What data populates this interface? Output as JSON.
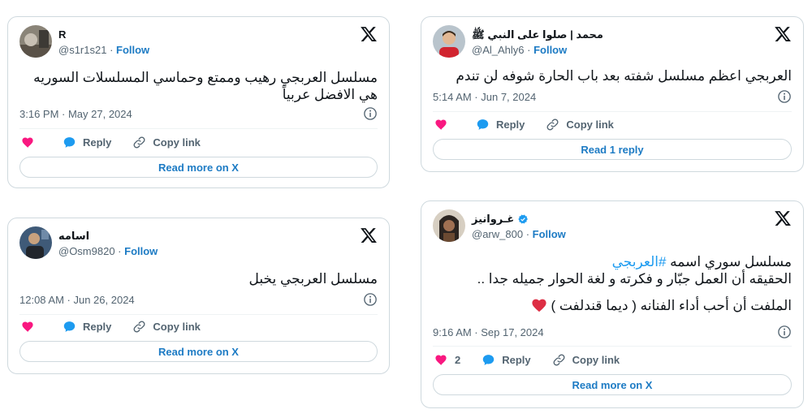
{
  "colors": {
    "accent": "#1d9bf0",
    "link": "#1d7bc4",
    "heart": "#f91880",
    "muted": "#536471",
    "border": "#cfd9de"
  },
  "tweets": [
    {
      "name": "R",
      "handle": "@s1r1s21",
      "follow": "Follow",
      "text_lines": [
        "مسلسل العربجي رهيب وممتع وحماسي المسلسلات السوريه",
        "هي الافضل عربياً"
      ],
      "timestamp": "3:16 PM · May 27, 2024",
      "actions": {
        "reply": "Reply",
        "copy": "Copy link"
      },
      "cta": "Read more on X"
    },
    {
      "name": "محمد | صلوا على النبي ﷺ",
      "handle": "@Al_Ahly6",
      "follow": "Follow",
      "text_lines": [
        "العربجي اعظم مسلسل شفته بعد باب الحارة شوفه لن تندم"
      ],
      "timestamp": "5:14 AM · Jun 7, 2024",
      "actions": {
        "reply": "Reply",
        "copy": "Copy link"
      },
      "cta": "Read 1 reply"
    },
    {
      "name": "اسامه",
      "handle": "@Osm9820",
      "follow": "Follow",
      "text_lines": [
        "مسلسل العربجي يخبل"
      ],
      "timestamp": "12:08 AM · Jun 26, 2024",
      "actions": {
        "reply": "Reply",
        "copy": "Copy link"
      },
      "cta": "Read more on X"
    },
    {
      "name": "غـروانيز",
      "handle": "@arw_800",
      "follow": "Follow",
      "text_line1_prefix": "مسلسل سوري اسمه ",
      "hashtag": "#العربجي",
      "text_line2": "الحقيقه أن العمل جبّار و فكرته و لغة الحوار جميله جدا ..",
      "text_line3": "الملفت أن أحب أداء الفنانه ( ديما قندلفت )",
      "timestamp": "9:16 AM · Sep 17, 2024",
      "like_count": "2",
      "actions": {
        "reply": "Reply",
        "copy": "Copy link"
      },
      "cta": "Read more on X"
    }
  ]
}
